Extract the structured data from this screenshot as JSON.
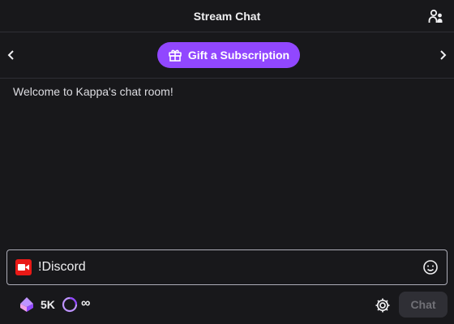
{
  "header": {
    "title": "Stream Chat",
    "users_icon": "users-icon"
  },
  "promo": {
    "left_icon": "chevron-left-icon",
    "right_icon": "chevron-right-icon",
    "gift_label": "Gift a Subscription",
    "gift_icon": "gift-icon"
  },
  "chat": {
    "welcome_message": "Welcome to Kappa's chat room!"
  },
  "input": {
    "value": "!Discord",
    "left_icon": "video-camera-icon",
    "emote_icon": "smiley-icon"
  },
  "bottom": {
    "points_icon": "channel-points-icon",
    "points_count": "5K",
    "ring_icon": "watch-streak-icon",
    "ring_value": "∞",
    "settings_icon": "gear-icon",
    "chat_label": "Chat"
  },
  "colors": {
    "background": "#18181b",
    "accent": "#9147ff",
    "text": "#efeff1",
    "camera_red": "#e91916",
    "button_disabled_bg": "#2f2f35",
    "button_disabled_text": "#707076"
  }
}
